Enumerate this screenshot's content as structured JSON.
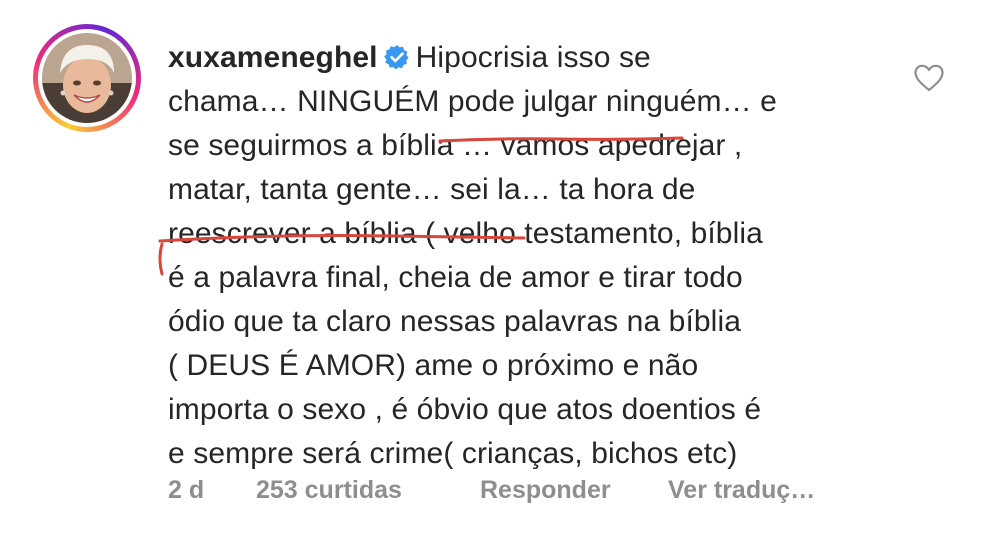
{
  "comment": {
    "username": "xuxameneghel",
    "verified_icon": "verified-badge-icon",
    "lines": [
      "Hipocrisia isso se",
      "chama… NINGUÉM pode julgar ninguém… e",
      "se seguirmos a bíblia … vamos apedrejar ,",
      "matar, tanta gente… sei la… ta hora de",
      "reescrever a bíblia ( velho testamento, bíblia",
      "é a palavra final, cheia de amor e tirar todo",
      "ódio que ta claro nessas palavras na bíblia",
      "( DEUS É AMOR) ame o próximo e não",
      "importa o sexo , é óbvio que atos doentios é",
      "e sempre será crime( crianças, bichos etc)"
    ],
    "like_icon": "heart-icon",
    "time": "2 d",
    "likes": "253 curtidas",
    "reply": "Responder",
    "translate": "Ver traduç…"
  },
  "colors": {
    "text": "#262626",
    "meta": "#8e8e8e",
    "verified": "#3897f0",
    "annotation": "#d9463b"
  }
}
